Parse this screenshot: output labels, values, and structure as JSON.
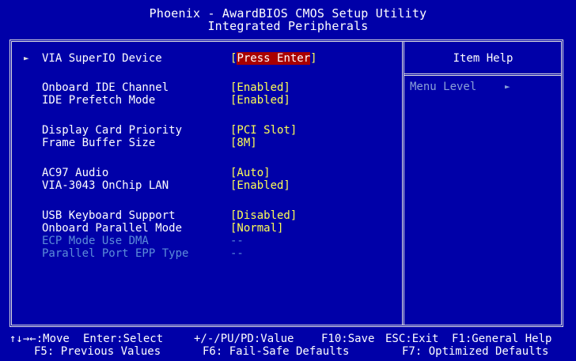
{
  "header": {
    "line1": "Phoenix - AwardBIOS CMOS Setup Utility",
    "line2": "Integrated Peripherals"
  },
  "settings": [
    {
      "label": "VIA SuperIO Device",
      "value_prefix": "[",
      "value_highlight": "Press Enter",
      "value_suffix": "]",
      "submenu": true
    },
    {
      "label": "Onboard IDE Channel",
      "value": "[Enabled]"
    },
    {
      "label": "IDE Prefetch Mode",
      "value": "[Enabled]"
    },
    {
      "label": "Display Card Priority",
      "value": "[PCI Slot]"
    },
    {
      "label": "Frame Buffer Size",
      "value": "[8M]"
    },
    {
      "label": "AC97 Audio",
      "value": "[Auto]"
    },
    {
      "label": "VIA-3043 OnChip LAN",
      "value": "[Enabled]"
    },
    {
      "label": "USB Keyboard Support",
      "value": "[Disabled]"
    },
    {
      "label": "Onboard Parallel Mode",
      "value": "[Normal]"
    },
    {
      "label": "ECP Mode Use DMA",
      "value": "--",
      "disabled": true
    },
    {
      "label": "Parallel Port EPP Type",
      "value": "--",
      "disabled": true
    }
  ],
  "help": {
    "title": "Item Help",
    "menu_level_label": "Menu Level",
    "menu_level_arrow": "►"
  },
  "submenu_arrow": "►",
  "footer": {
    "move": "↑↓→←:Move",
    "select": "Enter:Select",
    "value": "+/-/PU/PD:Value",
    "save": "F10:Save",
    "exit": "ESC:Exit",
    "general_help": "F1:General Help",
    "previous_values": "F5: Previous Values",
    "failsafe": "F6: Fail-Safe Defaults",
    "optimized": "F7: Optimized Defaults"
  },
  "colors": {
    "background": "#0000a8",
    "value": "#ffff54",
    "highlight": "#a80000",
    "disabled": "#5c8cd8"
  }
}
